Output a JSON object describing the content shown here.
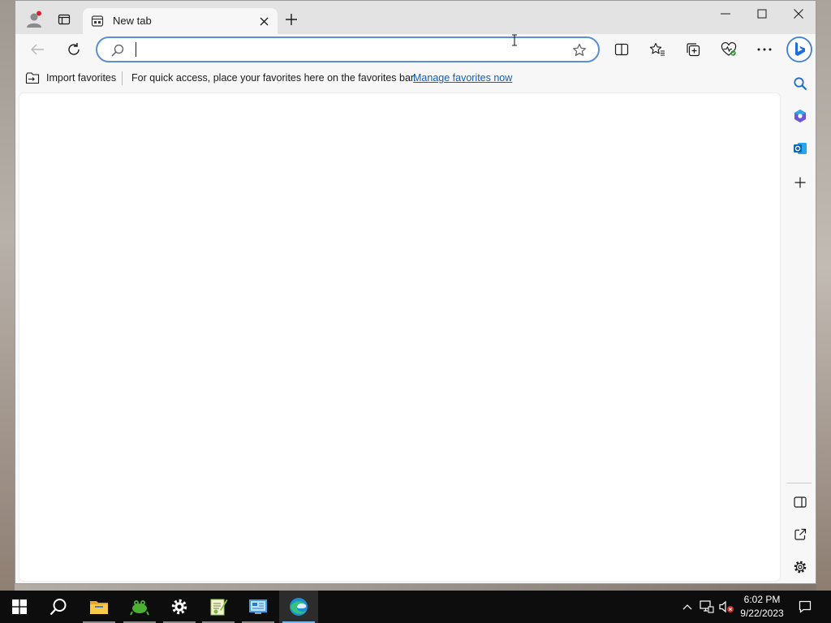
{
  "browser": {
    "tab": {
      "title": "New tab"
    },
    "address_bar": {
      "value": "",
      "placeholder": ""
    },
    "favorites_bar": {
      "import_label": "Import favorites",
      "message": "For quick access, place your favorites here on the favorites bar.",
      "manage_link": "Manage favorites now"
    },
    "accent_color": "#0f5ec0"
  },
  "taskbar": {
    "apps": [
      {
        "name": "Start",
        "icon": "windows-logo-icon"
      },
      {
        "name": "Search",
        "icon": "search-icon"
      },
      {
        "name": "File Explorer",
        "icon": "folder-icon"
      },
      {
        "name": "Frog app",
        "icon": "frog-icon"
      },
      {
        "name": "Settings",
        "icon": "gear-icon"
      },
      {
        "name": "Notepad++",
        "icon": "notepad-icon"
      },
      {
        "name": "Control Panel",
        "icon": "control-panel-icon"
      },
      {
        "name": "Microsoft Edge",
        "icon": "edge-icon"
      }
    ],
    "clock": {
      "time": "6:02 PM",
      "date": "9/22/2023"
    }
  }
}
